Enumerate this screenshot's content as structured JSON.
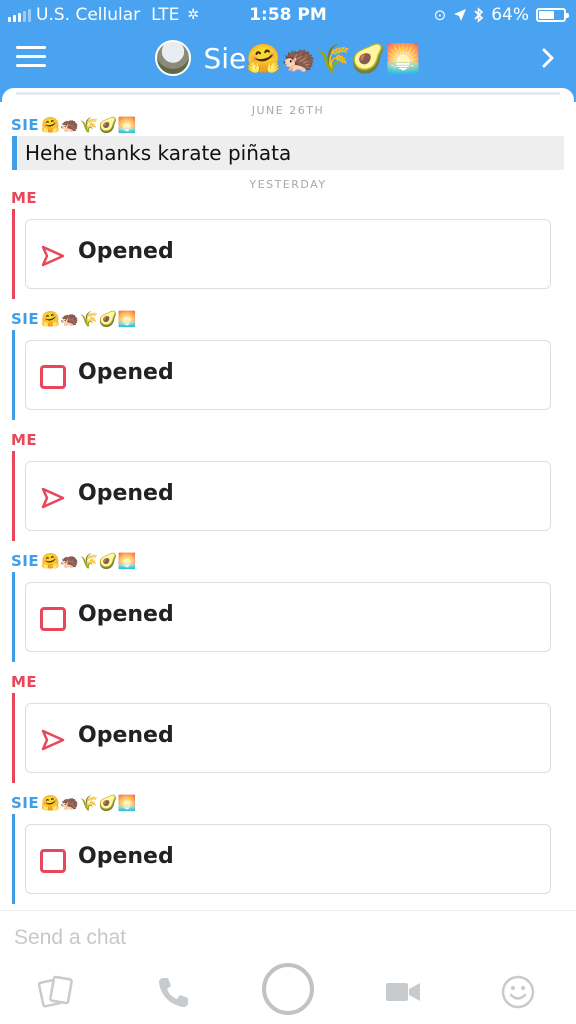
{
  "status_bar": {
    "carrier": "U.S. Cellular",
    "network": "LTE",
    "time": "1:58 PM",
    "battery_text": "64%",
    "battery_level": 0.64
  },
  "header": {
    "title": "Sie🤗🦔🌾🥑🌅",
    "menu_icon": "hamburger-menu-icon",
    "forward_icon": "chevron-right-icon"
  },
  "messages": {
    "date_1": "JUNE 26TH",
    "sender_1": "SIE",
    "sender_1_emoji": "🤗🦔🌾🥑🌅",
    "text_1": "Hehe thanks karate piñata",
    "date_2": "YESTERDAY",
    "snaps": [
      {
        "sender": "ME",
        "emoji": "",
        "label": "Opened",
        "icon": "sent-arrow-icon"
      },
      {
        "sender": "SIE",
        "emoji": "🤗🦔🌾🥑🌅",
        "label": "Opened",
        "icon": "received-square-icon"
      },
      {
        "sender": "ME",
        "emoji": "",
        "label": "Opened",
        "icon": "sent-arrow-icon"
      },
      {
        "sender": "SIE",
        "emoji": "🤗🦔🌾🥑🌅",
        "label": "Opened",
        "icon": "received-square-icon"
      },
      {
        "sender": "ME",
        "emoji": "",
        "label": "Opened",
        "icon": "sent-arrow-icon"
      },
      {
        "sender": "SIE",
        "emoji": "🤗🦔🌾🥑🌅",
        "label": "Opened",
        "icon": "received-square-icon"
      }
    ]
  },
  "composer": {
    "placeholder": "Send a chat",
    "actions": [
      "memories-icon",
      "phone-icon",
      "capture-button",
      "video-icon",
      "smiley-icon"
    ]
  },
  "colors": {
    "header_blue": "#4aa3f0",
    "sie_blue": "#3e9ee8",
    "me_red": "#e8475b"
  }
}
